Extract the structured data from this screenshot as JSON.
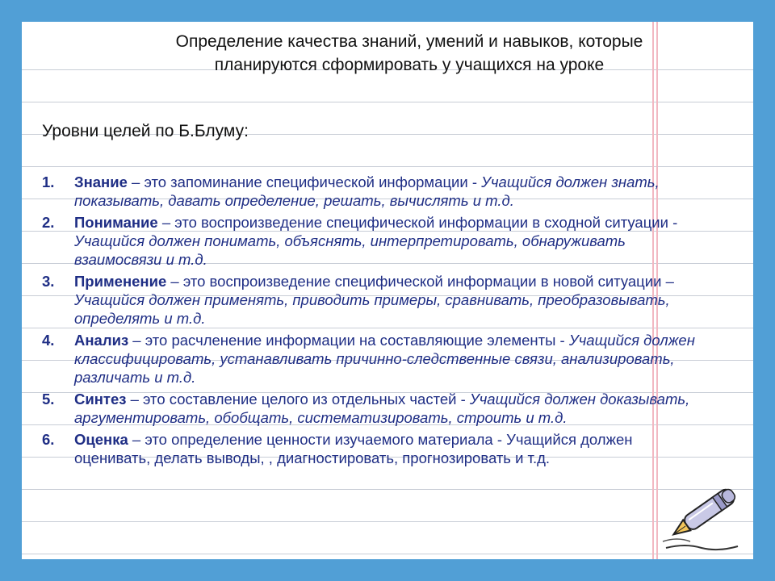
{
  "title": "Определение качества знаний, умений и навыков, которые планируются сформировать у учащихся на уроке",
  "subtitle": "Уровни целей по Б.Блуму:",
  "levels": [
    {
      "num": "1.",
      "term": "Знание",
      "def": " – это запоминание специфической информации - ",
      "act": "Учащийся должен знать, показывать, давать определение,  решать, вычислять и т.д."
    },
    {
      "num": "2.",
      "term": "Понимание",
      "def": " – это воспроизведение специфической информации в сходной ситуации - ",
      "act": "Учащийся должен понимать, объяснять, интерпретировать, обнаруживать взаимосвязи и т.д."
    },
    {
      "num": "3.",
      "term": "Применение",
      "def": " – это воспроизведение специфической информации в новой ситуации – ",
      "act": "Учащийся должен применять, приводить примеры, сравнивать, преобразовывать, определять  и т.д."
    },
    {
      "num": "4.",
      "term": "Анализ",
      "def": " – это расчленение информации на составляющие элементы - ",
      "act": "Учащийся должен классифицировать, устанавливать причинно-следственные связи, анализировать, различать и т.д."
    },
    {
      "num": "5.",
      "term": "Синтез",
      "def": " – это составление целого из отдельных частей - ",
      "act": "Учащийся должен доказывать, аргументировать, обобщать,  систематизировать, строить и т.д."
    },
    {
      "num": "6.",
      "term": "Оценка",
      "def": " – это определение ценности изучаемого материала -  Учащийся должен оценивать, делать выводы, , диагностировать, прогнозировать и т.д.",
      "act": ""
    }
  ],
  "decor": {
    "icon": "fountain-pen-icon"
  }
}
